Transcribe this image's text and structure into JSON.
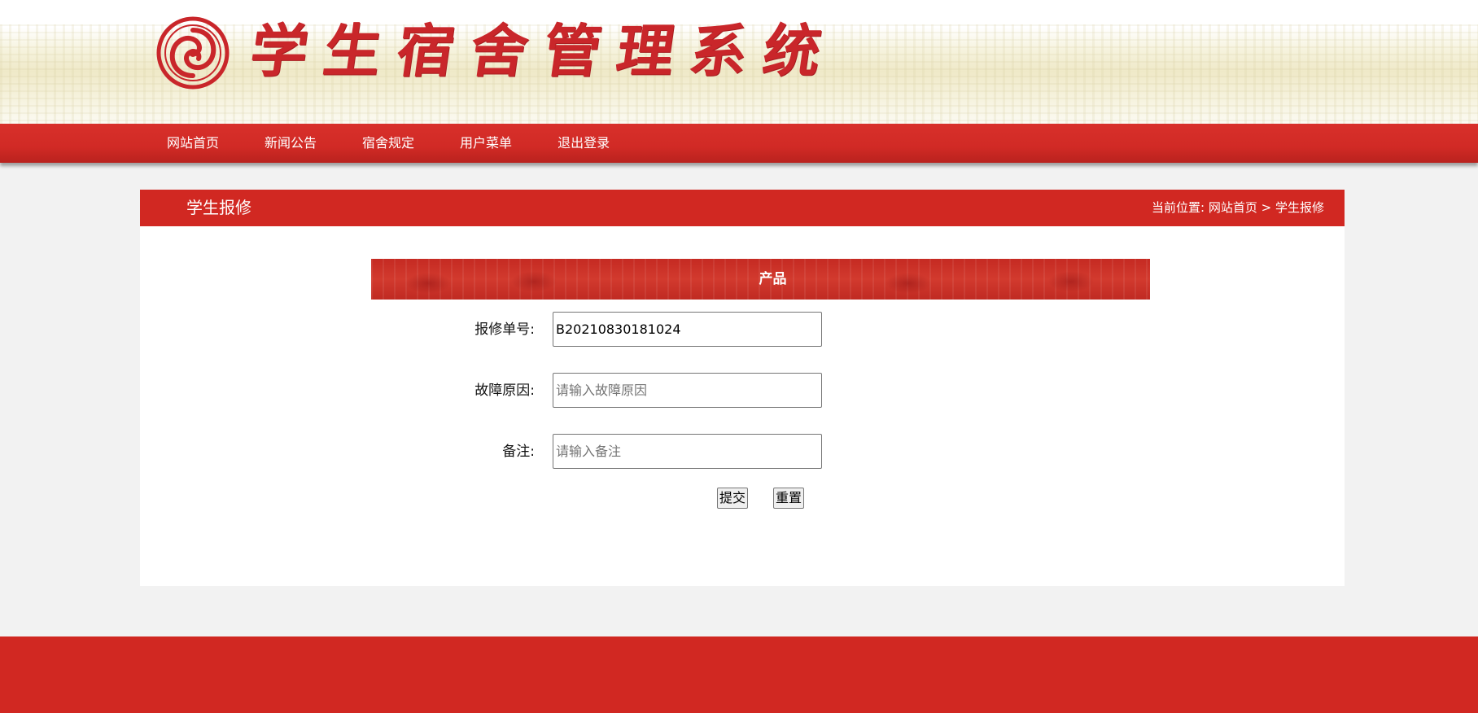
{
  "header": {
    "site_title": "学生宿舍管理系统",
    "logo_icon": "emblem-logo-icon",
    "brand_color": "#c9262a"
  },
  "nav": {
    "items": [
      {
        "label": "网站首页"
      },
      {
        "label": "新闻公告"
      },
      {
        "label": "宿舍规定"
      },
      {
        "label": "用户菜单"
      },
      {
        "label": "退出登录"
      }
    ]
  },
  "panel": {
    "title": "学生报修",
    "breadcrumb": {
      "prefix": "当前位置:",
      "home": "网站首页",
      "separator": ">",
      "current": "学生报修"
    },
    "section_label": "产品"
  },
  "form": {
    "repair_no": {
      "label": "报修单号:",
      "value": "B20210830181024",
      "placeholder": ""
    },
    "fault_reason": {
      "label": "故障原因:",
      "value": "",
      "placeholder": "请输入故障原因"
    },
    "remark": {
      "label": "备注:",
      "value": "",
      "placeholder": "请输入备注"
    },
    "submit_label": "提交",
    "reset_label": "重置"
  },
  "colors": {
    "accent": "#d12822",
    "background": "#f2f2f2"
  }
}
